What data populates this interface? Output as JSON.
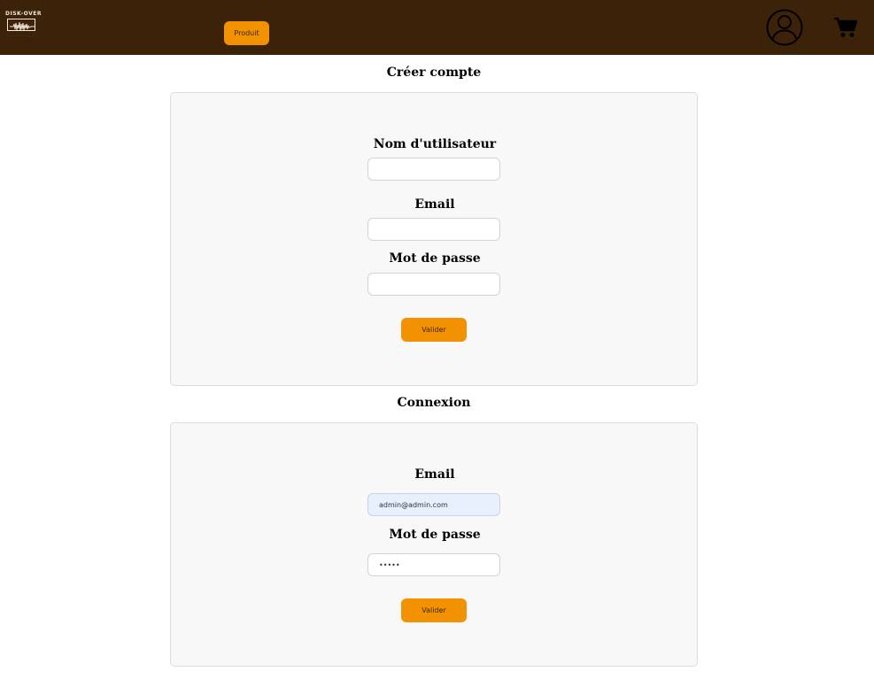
{
  "header": {
    "logo_title": "DISK-OVER",
    "logo_subtitle": "· · · · · · · · · · · · · · · ·",
    "produit_label": "Produit"
  },
  "signup": {
    "title": "Créer compte",
    "username_label": "Nom d'utilisateur",
    "username_value": "",
    "email_label": "Email",
    "email_value": "",
    "password_label": "Mot de passe",
    "password_value": "",
    "submit_label": "Valider"
  },
  "login": {
    "title": "Connexion",
    "email_label": "Email",
    "email_value": "admin@admin.com",
    "password_label": "Mot de passe",
    "password_value": "•••••",
    "submit_label": "Valider"
  },
  "colors": {
    "header_bg": "#3d220a",
    "button_bg": "#f39200",
    "card_bg": "#f8f8f8"
  },
  "icons": [
    "logo-icon",
    "user-icon",
    "cart-icon"
  ]
}
